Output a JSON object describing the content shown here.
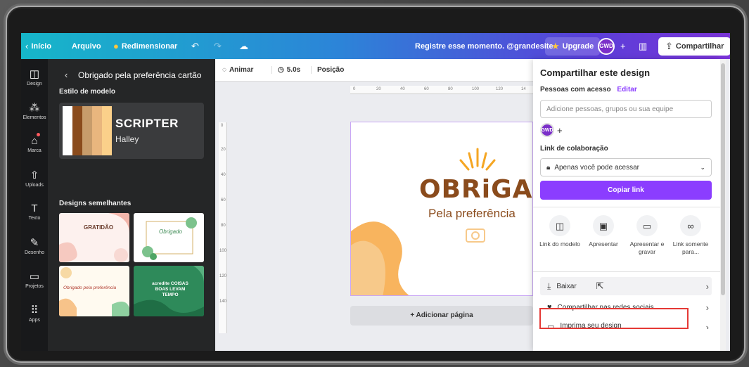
{
  "topbar": {
    "home": "Início",
    "file": "Arquivo",
    "resize": "Redimensionar",
    "design_title": "Registre esse momento. @grandesite",
    "upgrade": "Upgrade",
    "avatar": "GWD",
    "share": "Compartilhar"
  },
  "rail": {
    "design": "Design",
    "elements": "Elementos",
    "brand": "Marca",
    "uploads": "Uploads",
    "text": "Texto",
    "draw": "Desenho",
    "projects": "Projetos",
    "apps": "Apps"
  },
  "panel": {
    "title": "Obrigado pela preferência cartão",
    "style_section": "Estilo de modelo",
    "style_font": "SCRIPTER",
    "style_sub": "Halley",
    "style_colors": [
      "#ffffff",
      "#8a4b1c",
      "#c79c6b",
      "#e9b67e",
      "#fbd08a"
    ],
    "similar_section": "Designs semelhantes",
    "thumbs": [
      {
        "title": "GRATIDÃO"
      },
      {
        "title": "Obrigado"
      },
      {
        "title": "Obrigado pela preferência"
      },
      {
        "title": "acredite COISAS BOAS LEVAM TEMPO"
      }
    ]
  },
  "toolbar": {
    "animate": "Animar",
    "duration": "5.0s",
    "position": "Posição"
  },
  "rulers": {
    "h": [
      "0",
      "20",
      "40",
      "60",
      "80",
      "100",
      "120",
      "14"
    ],
    "v": [
      "0",
      "20",
      "40",
      "60",
      "80",
      "100",
      "120",
      "140"
    ]
  },
  "canvas": {
    "headline": "OBRiGADO",
    "subline": "Pela preferência",
    "add_page": "+ Adicionar página"
  },
  "share": {
    "heading": "Compartilhar este design",
    "people_label": "Pessoas com acesso",
    "edit": "Editar",
    "input_placeholder": "Adicione pessoas, grupos ou sua equipe",
    "collab_label": "Link de colaboração",
    "access_value": "Apenas você pode acessar",
    "copy_link": "Copiar link",
    "options": [
      {
        "label": "Link do modelo"
      },
      {
        "label": "Apresentar"
      },
      {
        "label": "Apresentar e gravar"
      },
      {
        "label": "Link somente para..."
      }
    ],
    "download": "Baixar",
    "social": "Compartilhar nas redes sociais",
    "print": "Imprima seu design"
  }
}
